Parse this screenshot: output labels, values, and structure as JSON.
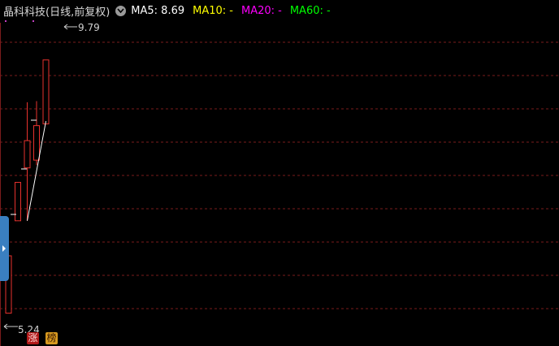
{
  "header": {
    "title": "晶科科技(日线,前复权)",
    "ma": [
      {
        "label": "MA5: 8.69",
        "color": "#ffffff"
      },
      {
        "label": "MA10: -",
        "color": "#ffff00"
      },
      {
        "label": "MA20: -",
        "color": "#ff00ff"
      },
      {
        "label": "MA60: -",
        "color": "#00ff00"
      }
    ]
  },
  "colors": {
    "background": "#000000",
    "grid": "#7a1c1c",
    "candle_up": "#e8322e",
    "ma5": "#ffffff"
  },
  "chart_data": {
    "type": "candlestick",
    "ylim": [
      5.0,
      10.4
    ],
    "candles": [
      {
        "open": 5.24,
        "close": 6.27,
        "high": 6.27,
        "low": 5.24
      },
      {
        "open": 6.9,
        "close": 7.59,
        "high": 7.59,
        "low": 6.9
      },
      {
        "open": 7.85,
        "close": 8.34,
        "high": 9.03,
        "low": 6.9
      },
      {
        "open": 7.99,
        "close": 8.61,
        "high": 9.05,
        "low": 7.9
      },
      {
        "open": 8.64,
        "close": 9.79,
        "high": 9.79,
        "low": 8.63
      }
    ],
    "ma5": [
      {
        "index": 2,
        "value": 6.9
      },
      {
        "index": 4,
        "value": 8.69
      }
    ],
    "annotations": {
      "high_label": "9.79",
      "low_label": "5.24"
    }
  },
  "badges": {
    "zhang": "涨",
    "bang": "榜"
  }
}
